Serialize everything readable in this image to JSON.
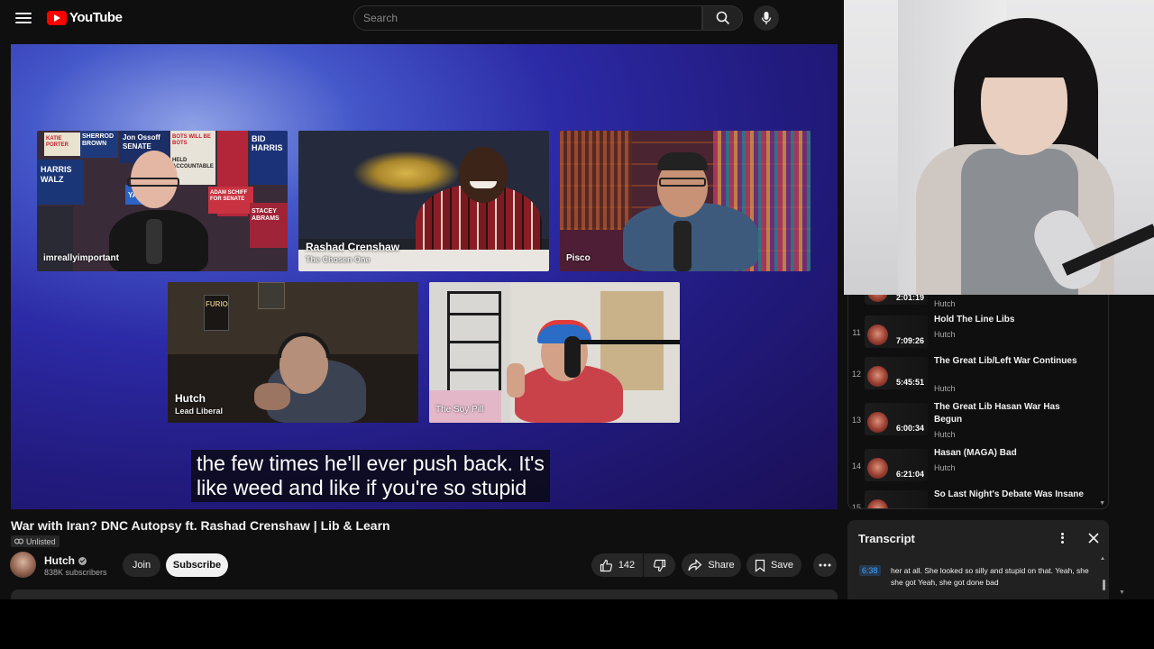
{
  "masthead": {
    "logo_text": "YouTube",
    "search_placeholder": "Search"
  },
  "player": {
    "participants": [
      {
        "name": "imreallyimportant",
        "subtitle": ""
      },
      {
        "name": "Rashad Crenshaw",
        "subtitle": "The Chosen One"
      },
      {
        "name": "Pisco",
        "subtitle": ""
      },
      {
        "name": "Hutch",
        "subtitle": "Lead Liberal"
      },
      {
        "name": "The Soy Pill",
        "subtitle": ""
      }
    ],
    "background_sign_text": "FURIO",
    "poster_texts": [
      "SHERROD BROWN",
      "Jon Ossoff SENATE",
      "HARRIS WALZ",
      "YANG",
      "BID HARRIS",
      "ADAM SCHIFF FOR SENATE",
      "STACEY ABRAMS",
      "HELD ACCOUNTABLE",
      "KATIE PORTER",
      "BOTS WILL BE BOTS"
    ],
    "caption_line_1": "the few times he'll ever push back. It's",
    "caption_line_2": "like weed and like if you're so stupid"
  },
  "video": {
    "title": "War with Iran? DNC Autopsy ft. Rashad Crenshaw | Lib & Learn",
    "visibility": "Unlisted",
    "channel_name": "Hutch",
    "subscribers": "838K subscribers",
    "join_label": "Join",
    "subscribe_label": "Subscribe",
    "like_count": "142",
    "share_label": "Share",
    "save_label": "Save"
  },
  "playlist": {
    "items": [
      {
        "index": "",
        "duration": "2:01:19",
        "title": "",
        "channel": "Hutch"
      },
      {
        "index": "11",
        "duration": "7:09:26",
        "title": "Hold The Line Libs",
        "channel": "Hutch"
      },
      {
        "index": "12",
        "duration": "5:45:51",
        "title": "The Great Lib/Left War Continues",
        "channel": "Hutch"
      },
      {
        "index": "13",
        "duration": "6:00:34",
        "title": "The Great Lib Hasan War Has Begun",
        "channel": "Hutch"
      },
      {
        "index": "14",
        "duration": "6:21:04",
        "title": "Hasan (MAGA) Bad",
        "channel": "Hutch"
      },
      {
        "index": "15",
        "duration": "",
        "title": "So Last Night's Debate Was Insane",
        "channel": ""
      }
    ]
  },
  "transcript": {
    "title": "Transcript",
    "segment_time": "6:38",
    "segment_text": "her at all. She looked so silly and stupid on that. Yeah, she she got Yeah, she got done bad"
  },
  "colors": {
    "accent_red": "#ff0000",
    "timestamp_blue": "#3ea6ff",
    "background": "#0f0f0f"
  }
}
